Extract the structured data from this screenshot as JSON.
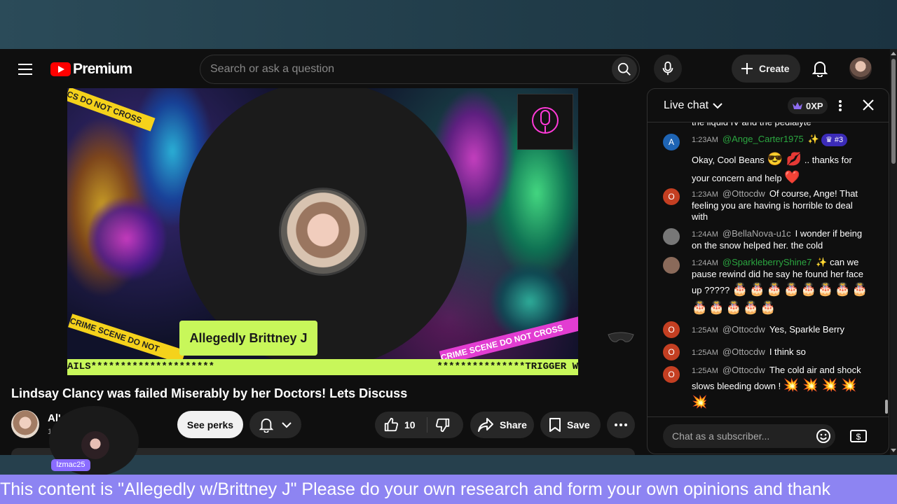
{
  "header": {
    "logo_text": "Premium",
    "search_placeholder": "Search or ask a question",
    "create_label": "Create"
  },
  "video": {
    "name_bar": "Allegedly Brittney J",
    "ticker_left": "AILS*********************",
    "ticker_right": "***************TRIGGER W",
    "tape_left": "CRIME SCENE DO NOT",
    "tape_right": "CRIME SCENE DO NOT CROSS",
    "tape_top": "CS DO NOT CROSS"
  },
  "below_video": {
    "title": "Lindsay Clancy was failed Miserably by her Doctors! Lets Discuss",
    "channel_name": "Al' ttney J",
    "channel_subs": "1",
    "perks_label": "See perks",
    "like_count": "10",
    "share_label": "Share",
    "save_label": "Save"
  },
  "overlay": {
    "username": "lzmac25"
  },
  "banner": {
    "text": "This content is \"Allegedly w/Brittney J\" Please do your own research and form your own opinions and thank"
  },
  "chat": {
    "title": "Live chat",
    "xp": "0XP",
    "input_placeholder": "Chat as a subscriber...",
    "cut_top": "the liquid IV and the pedialyte",
    "messages": [
      {
        "avatar": "A",
        "avatar_color": "#1e64b4",
        "time": "1:23AM",
        "author": "@Ange_Carter1975",
        "author_green": true,
        "badge": "✨",
        "rank": "#3",
        "text": "Okay, Cool Beans",
        "emoji_mid": "😎 💋",
        "text2": ".. thanks for your concern and help",
        "emoji_end": "❤️"
      },
      {
        "avatar": "O",
        "avatar_color": "#c43f22",
        "time": "1:23AM",
        "author": "@Ottocdw",
        "text": "Of course, Ange! That feeling you are having is horrible to deal with"
      },
      {
        "avatar": "",
        "avatar_color": "#777777",
        "time": "1:24AM",
        "author": "@BellaNova-u1c",
        "text": "I wonder if being on the snow helped her. the cold"
      },
      {
        "avatar": "",
        "avatar_color": "#8a6a5a",
        "time": "1:24AM",
        "author": "@SparkleberryShine7",
        "author_green": true,
        "badge": "✨",
        "text": "can we pause rewind did he say he found her face up ?????",
        "emoji_end": "🎂🎂🎂🎂🎂🎂🎂🎂🎂🎂🎂🎂🎂"
      },
      {
        "avatar": "O",
        "avatar_color": "#c43f22",
        "time": "1:25AM",
        "author": "@Ottocdw",
        "text": "Yes, Sparkle Berry"
      },
      {
        "avatar": "O",
        "avatar_color": "#c43f22",
        "time": "1:25AM",
        "author": "@Ottocdw",
        "text": "I think so"
      },
      {
        "avatar": "O",
        "avatar_color": "#c43f22",
        "time": "1:25AM",
        "author": "@Ottocdw",
        "text": "The cold air and shock slows bleeding down !",
        "emoji_end": "💥 💥 💥 💥 💥"
      }
    ]
  },
  "icons": {
    "menu": "hamburger-icon",
    "search": "search-icon",
    "mic": "mic-icon",
    "create": "plus-icon",
    "notifications": "bell-icon",
    "like": "thumbs-up-icon",
    "dislike": "thumbs-down-icon",
    "share": "share-icon",
    "save": "bookmark-icon",
    "more": "more-horizontal-icon",
    "crown": "crown-icon",
    "close": "close-icon",
    "emoji": "emoji-icon",
    "super_chat": "dollar-icon"
  },
  "colors": {
    "brand_red": "#ff0000",
    "name_bar": "#c8f75a",
    "banner": "#8d84f2",
    "chat_author_green": "#2ba640",
    "rank_badge": "#3b2bb8"
  }
}
